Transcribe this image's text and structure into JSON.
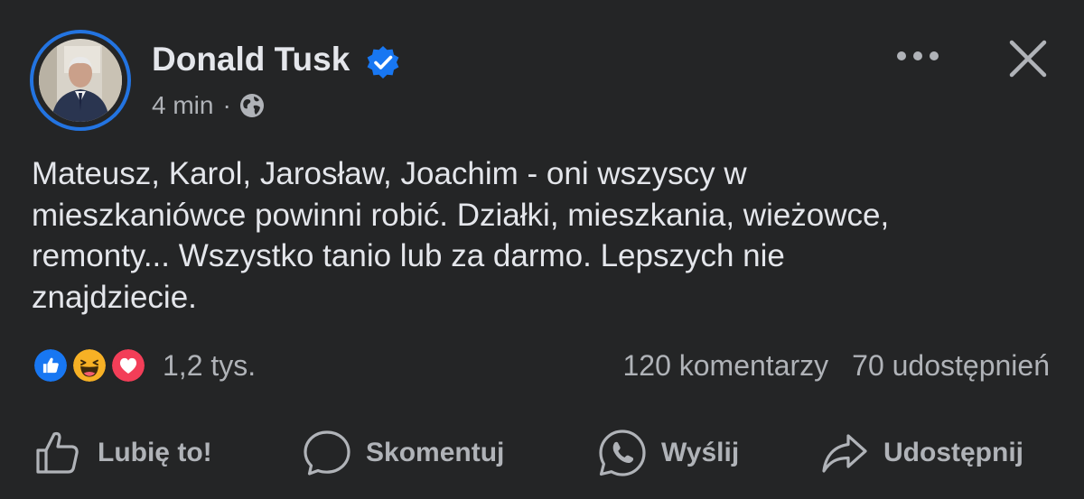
{
  "post": {
    "author": "Donald Tusk",
    "time": "4 min",
    "separator": "·",
    "text": "Mateusz, Karol, Jarosław, Joachim - oni wszyscy w mieszkaniówce powinni robić. Działki, mieszkania, wieżowce, remonty... Wszystko tanio lub za darmo. Lepszych nie znajdziecie."
  },
  "stats": {
    "reactions": "1,2 tys.",
    "comments": "120 komentarzy",
    "shares": "70 udostępnień"
  },
  "actions": {
    "like": "Lubię to!",
    "comment": "Skomentuj",
    "send": "Wyślij",
    "share": "Udostępnij"
  },
  "icons": {
    "verified": "verified-badge-icon",
    "privacy": "globe-icon",
    "more": "more-options-icon",
    "close": "close-icon",
    "reaction_1": "like-reaction-icon",
    "reaction_2": "haha-reaction-icon",
    "reaction_3": "love-reaction-icon"
  },
  "colors": {
    "background": "#242526",
    "primary_text": "#e4e6eb",
    "secondary_text": "#b0b3b8",
    "accent": "#2374e1",
    "like_blue": "#1877f2",
    "love_red": "#f33e58",
    "haha_yellow": "#f7b125"
  }
}
